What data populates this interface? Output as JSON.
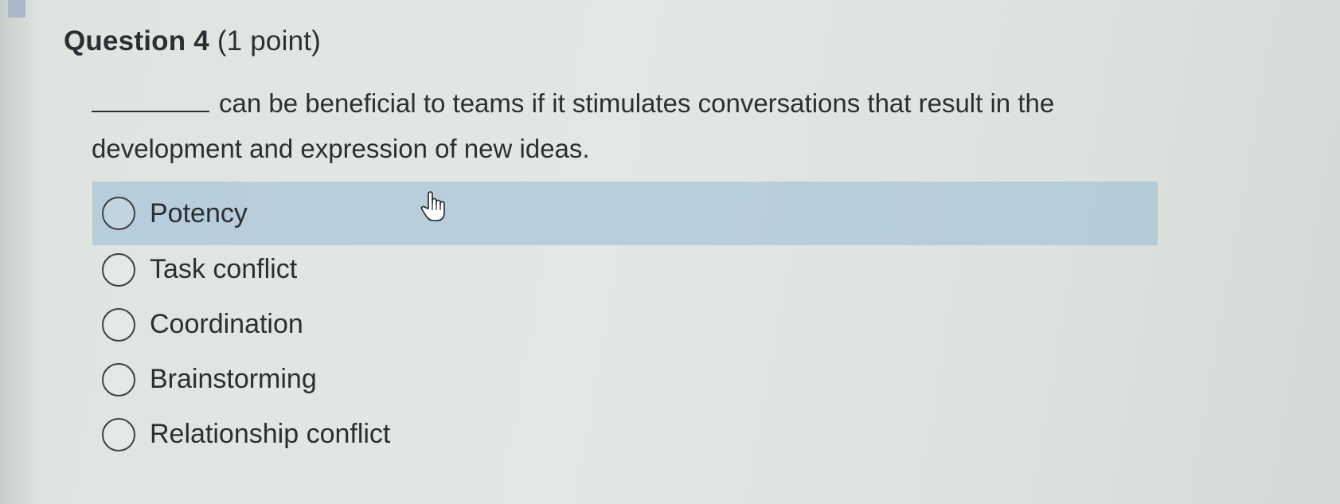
{
  "question": {
    "number_label": "Question 4",
    "points_label": "(1 point)",
    "prompt_text": "can be beneficial to teams if it stimulates conversations that result in the development and expression of new ideas."
  },
  "options": [
    {
      "label": "Potency",
      "hovered": true
    },
    {
      "label": "Task conflict",
      "hovered": false
    },
    {
      "label": "Coordination",
      "hovered": false
    },
    {
      "label": "Brainstorming",
      "hovered": false
    },
    {
      "label": "Relationship conflict",
      "hovered": false
    }
  ],
  "colors": {
    "background": "#e0e4e0",
    "hover_highlight": "#b4c8da",
    "text": "#2b2f33"
  },
  "icons": {
    "cursor": "hand-pointer-icon"
  }
}
